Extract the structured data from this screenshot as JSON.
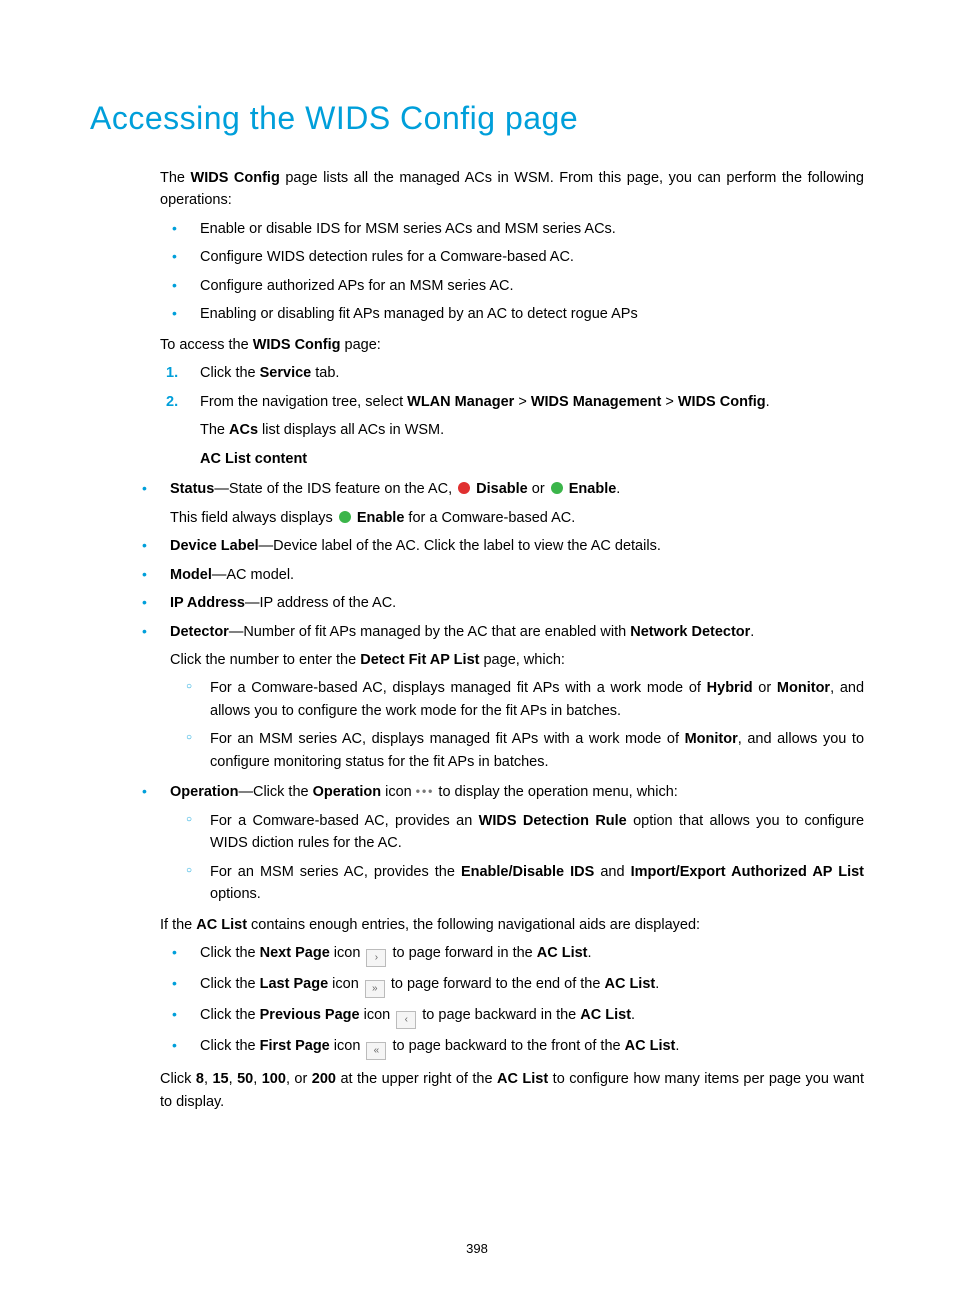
{
  "pageNumber": "398",
  "heading": "Accessing the WIDS Config page",
  "intro": {
    "pre": "The ",
    "bold1": "WIDS Config",
    "post": " page lists all the managed ACs in WSM. From this page, you can perform the following operations:"
  },
  "opsList": [
    "Enable or disable IDS for MSM series ACs and MSM series ACs.",
    "Configure WIDS detection rules for a Comware-based AC.",
    "Configure authorized APs for an MSM series AC.",
    "Enabling or disabling fit APs managed by an AC to detect rogue APs"
  ],
  "access": {
    "pre": "To access the ",
    "bold": "WIDS Config",
    "post": " page:"
  },
  "step1": {
    "num": "1.",
    "pre": "Click the ",
    "bold": "Service",
    "post": " tab."
  },
  "step2": {
    "num": "2.",
    "pre": "From the navigation tree, select ",
    "b1": "WLAN Manager",
    "sep": " > ",
    "b2": "WIDS Management",
    "b3": "WIDS Config",
    "end": ".",
    "line2pre": "The ",
    "line2b": "ACs",
    "line2post": " list displays all ACs in WSM.",
    "heading": "AC List content"
  },
  "status": {
    "label": "Status",
    "t1": "—State of the IDS feature on the AC, ",
    "disableColor": "#e03030",
    "disableText": "Disable",
    "or": " or ",
    "enableColor": "#3bb54a",
    "enableText": "Enable",
    "end": ".",
    "line2a": "This field always displays ",
    "line2enable": "Enable",
    "line2b": " for a Comware-based AC."
  },
  "deviceLabel": {
    "label": "Device Label",
    "text": "—Device label of the AC. Click the label to view the AC details."
  },
  "model": {
    "label": "Model",
    "text": "—AC model."
  },
  "ip": {
    "label": "IP Address",
    "text": "—IP address of the AC."
  },
  "detector": {
    "label": "Detector",
    "t1": "—Number of fit APs managed by the AC that are enabled with ",
    "b1": "Network Detector",
    "end": ".",
    "l2a": "Click the number to enter the ",
    "l2b": "Detect Fit AP List",
    "l2c": " page, which:",
    "sub1a": "For a Comware-based AC, displays managed fit APs with a work mode of ",
    "sub1b1": "Hybrid",
    "sub1or": " or ",
    "sub1b2": "Monitor",
    "sub1c": ", and allows you to configure the work mode for the fit APs in batches.",
    "sub2a": "For an MSM series AC, displays managed fit APs with a work mode of ",
    "sub2b": "Monitor",
    "sub2c": ", and allows you to configure monitoring status for the fit APs in batches."
  },
  "operation": {
    "label": "Operation",
    "t1": "—Click the ",
    "b1": "Operation",
    "t2": " icon ",
    "t3": " to display the operation menu, which:",
    "sub1a": "For a Comware-based AC, provides an ",
    "sub1b": "WIDS Detection Rule",
    "sub1c": " option that allows you to configure WIDS diction rules for the AC.",
    "sub2a": "For an MSM series AC, provides the ",
    "sub2b": "Enable/Disable IDS",
    "sub2and": " and ",
    "sub2c": "Import/Export Authorized AP List",
    "sub2d": " options."
  },
  "navIntro": {
    "a": "If the ",
    "b": "AC List",
    "c": " contains enough entries, the following navigational aids are displayed:"
  },
  "navItems": {
    "next": {
      "a": "Click the ",
      "b": "Next Page",
      "c": " icon ",
      "glyph": "›",
      "d": " to page forward in the ",
      "e": "AC List",
      "f": "."
    },
    "last": {
      "a": "Click the ",
      "b": "Last Page",
      "c": " icon ",
      "glyph": "»",
      "d": " to page forward to the end of the ",
      "e": "AC List",
      "f": "."
    },
    "prev": {
      "a": "Click the ",
      "b": "Previous Page",
      "c": " icon ",
      "glyph": "‹",
      "d": " to page backward in the ",
      "e": "AC List",
      "f": "."
    },
    "first": {
      "a": "Click the ",
      "b": "First Page",
      "c": " icon ",
      "glyph": "«",
      "d": " to page backward to the front of the ",
      "e": "AC List",
      "f": "."
    }
  },
  "footer": {
    "a": "Click ",
    "n1": "8",
    "s": ", ",
    "n2": "15",
    "n3": "50",
    "n4": "100",
    "or": ", or ",
    "n5": "200",
    "b": " at the upper right of the ",
    "c": "AC List",
    "d": " to configure how many items per page you want to display."
  }
}
